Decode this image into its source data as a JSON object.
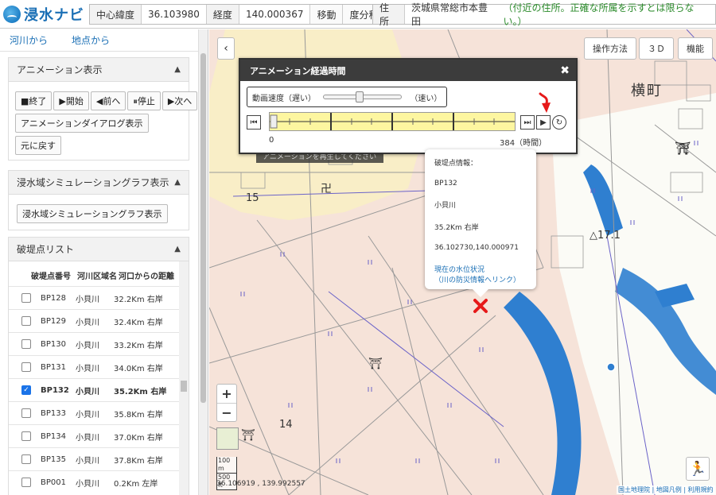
{
  "header": {
    "logo_text": "浸水ナビ",
    "center_label": "中心緯度",
    "lat_value": "36.103980",
    "lon_label": "経度",
    "lon_value": "140.000367",
    "move_button": "移動",
    "dms_button": "度分秒",
    "address_label": "住所",
    "address_value": "茨城県常総市本豊田",
    "address_note": "（付近の住所。正確な所属を示すとは限らない。）"
  },
  "sidebar": {
    "tabs": [
      "河川から",
      "地点から"
    ],
    "animation_panel": {
      "title": "アニメーション表示",
      "buttons": [
        "■終了",
        "▶開始",
        "◀前へ",
        "⏸停止",
        "▶次へ"
      ],
      "dialog_button": "アニメーションダイアログ表示",
      "back_button": "元に戻す"
    },
    "graph_panel": {
      "title": "浸水域シミュレーショングラフ表示",
      "button": "浸水域シミュレーショングラフ表示"
    },
    "breach_panel": {
      "title": "破堤点リスト",
      "columns": [
        "破堤点番号",
        "河川区域名",
        "河口からの距離"
      ],
      "rows": [
        {
          "id": "BP128",
          "river": "小貝川",
          "dist": "32.2Km 右岸",
          "checked": false
        },
        {
          "id": "BP129",
          "river": "小貝川",
          "dist": "32.4Km 右岸",
          "checked": false
        },
        {
          "id": "BP130",
          "river": "小貝川",
          "dist": "33.2Km 右岸",
          "checked": false
        },
        {
          "id": "BP131",
          "river": "小貝川",
          "dist": "34.0Km 右岸",
          "checked": false
        },
        {
          "id": "BP132",
          "river": "小貝川",
          "dist": "35.2Km 右岸",
          "checked": true
        },
        {
          "id": "BP133",
          "river": "小貝川",
          "dist": "35.8Km 右岸",
          "checked": false
        },
        {
          "id": "BP134",
          "river": "小貝川",
          "dist": "37.0Km 右岸",
          "checked": false
        },
        {
          "id": "BP135",
          "river": "小貝川",
          "dist": "37.8Km 右岸",
          "checked": false
        },
        {
          "id": "BP001",
          "river": "小貝川",
          "dist": "0.2Km 左岸",
          "checked": false
        }
      ]
    }
  },
  "map": {
    "buttons": [
      "操作方法",
      "３Ｄ",
      "機能"
    ],
    "labels": {
      "yoko": "横町",
      "elev": "△17.1",
      "n15": "15",
      "n14": "14"
    },
    "coords": "36.106919 , 139.992557",
    "scale_100m": "100 m",
    "scale_500ft": "500 ft",
    "credits": "国土地理院 | 地図凡例 | 利用規約",
    "tooltip": "アニメーションを再生してください"
  },
  "animation_dialog": {
    "title": "アニメーション経過時間",
    "speed_label": "動画速度（遅い）",
    "speed_fast": "（速い）",
    "start_value": "0",
    "end_value": "384（時間）"
  },
  "popup": {
    "heading": "破堤点情報：",
    "id": "BP132",
    "river": "小貝川",
    "dist": "35.2Km 右岸",
    "coords": "36.102730,140.000971",
    "link1": "現在の水位状況",
    "link2": "（川の防災情報へリンク）"
  }
}
